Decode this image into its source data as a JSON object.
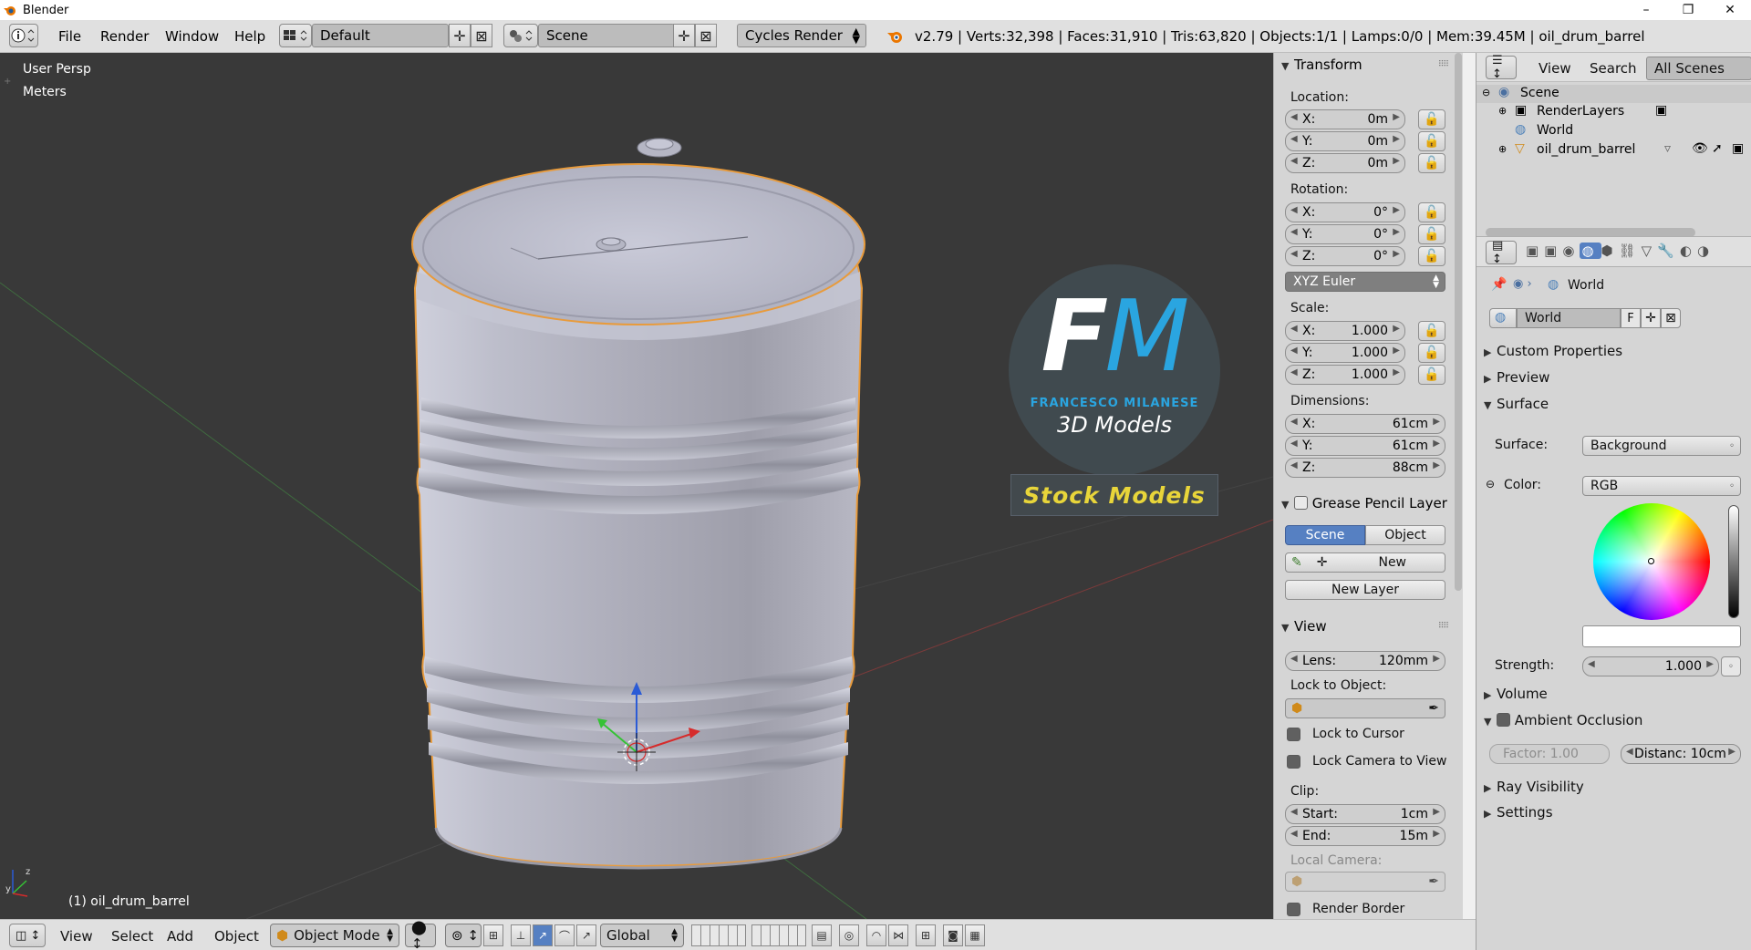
{
  "window": {
    "title": "Blender",
    "min": "–",
    "max": "❐",
    "close": "✕"
  },
  "info_header": {
    "menus": [
      "File",
      "Render",
      "Window",
      "Help"
    ],
    "screen_layout": "Default",
    "scene": "Scene",
    "render_engine": "Cycles Render",
    "stats": "v2.79 | Verts:32,398 | Faces:31,910 | Tris:63,820 | Objects:1/1 | Lamps:0/0 | Mem:39.45M | oil_drum_barrel"
  },
  "viewport": {
    "view_name": "User Persp",
    "units": "Meters",
    "active_object": "(1) oil_drum_barrel",
    "watermark": {
      "monogram_f": "F",
      "monogram_m": "M",
      "subtitle": "FRANCESCO MILANESE",
      "tagline": "3D Models",
      "badge": "Stock Models"
    }
  },
  "properties_panel": {
    "transform": {
      "title": "Transform",
      "location_label": "Location:",
      "location": [
        {
          "axis": "X:",
          "value": "0m"
        },
        {
          "axis": "Y:",
          "value": "0m"
        },
        {
          "axis": "Z:",
          "value": "0m"
        }
      ],
      "rotation_label": "Rotation:",
      "rotation": [
        {
          "axis": "X:",
          "value": "0°"
        },
        {
          "axis": "Y:",
          "value": "0°"
        },
        {
          "axis": "Z:",
          "value": "0°"
        }
      ],
      "rotation_mode": "XYZ Euler",
      "scale_label": "Scale:",
      "scale": [
        {
          "axis": "X:",
          "value": "1.000"
        },
        {
          "axis": "Y:",
          "value": "1.000"
        },
        {
          "axis": "Z:",
          "value": "1.000"
        }
      ],
      "dimensions_label": "Dimensions:",
      "dimensions": [
        {
          "axis": "X:",
          "value": "61cm"
        },
        {
          "axis": "Y:",
          "value": "61cm"
        },
        {
          "axis": "Z:",
          "value": "88cm"
        }
      ]
    },
    "grease_pencil": {
      "title": "Grease Pencil Layer",
      "tab_scene": "Scene",
      "tab_object": "Object",
      "new_label": "New",
      "new_layer_label": "New Layer"
    },
    "view": {
      "title": "View",
      "lens_label": "Lens:",
      "lens_value": "120mm",
      "lock_to_object_label": "Lock to Object:",
      "lock_to_cursor": "Lock to Cursor",
      "lock_camera_to_view": "Lock Camera to View",
      "clip_label": "Clip:",
      "clip_start_label": "Start:",
      "clip_start_value": "1cm",
      "clip_end_label": "End:",
      "clip_end_value": "15m",
      "local_camera_label": "Local Camera:",
      "render_border": "Render Border"
    }
  },
  "outliner": {
    "header": {
      "view": "View",
      "search": "Search",
      "filter": "All Scenes"
    },
    "rows": [
      {
        "label": "Scene"
      },
      {
        "label": "RenderLayers"
      },
      {
        "label": "World"
      },
      {
        "label": "oil_drum_barrel"
      }
    ]
  },
  "world_properties": {
    "breadcrumb": "World",
    "datablock_name": "World",
    "fake_user": "F",
    "panels": {
      "custom_properties": "Custom Properties",
      "preview": "Preview",
      "surface": "Surface",
      "volume": "Volume",
      "ambient_occlusion": "Ambient Occlusion",
      "ray_visibility": "Ray Visibility",
      "settings": "Settings"
    },
    "surface_label": "Surface:",
    "surface_value": "Background",
    "color_label": "Color:",
    "color_mode": "RGB",
    "color_value": "#ffffff",
    "strength_label": "Strength:",
    "strength_value": "1.000",
    "ao_factor": "Factor:   1.00",
    "ao_distance": "Distanc: 10cm"
  },
  "viewport_header": {
    "menus": [
      "View",
      "Select",
      "Add",
      "Object"
    ],
    "mode": "Object Mode",
    "orientation": "Global"
  },
  "colors": {
    "viewport_bg": "#393939",
    "selection_outline": "#e89b3c",
    "panel_bg": "#d5d5d5",
    "active_tab": "#5680c2",
    "watermark_accent": "#2aa5e0",
    "badge_text": "#e8d53a"
  }
}
